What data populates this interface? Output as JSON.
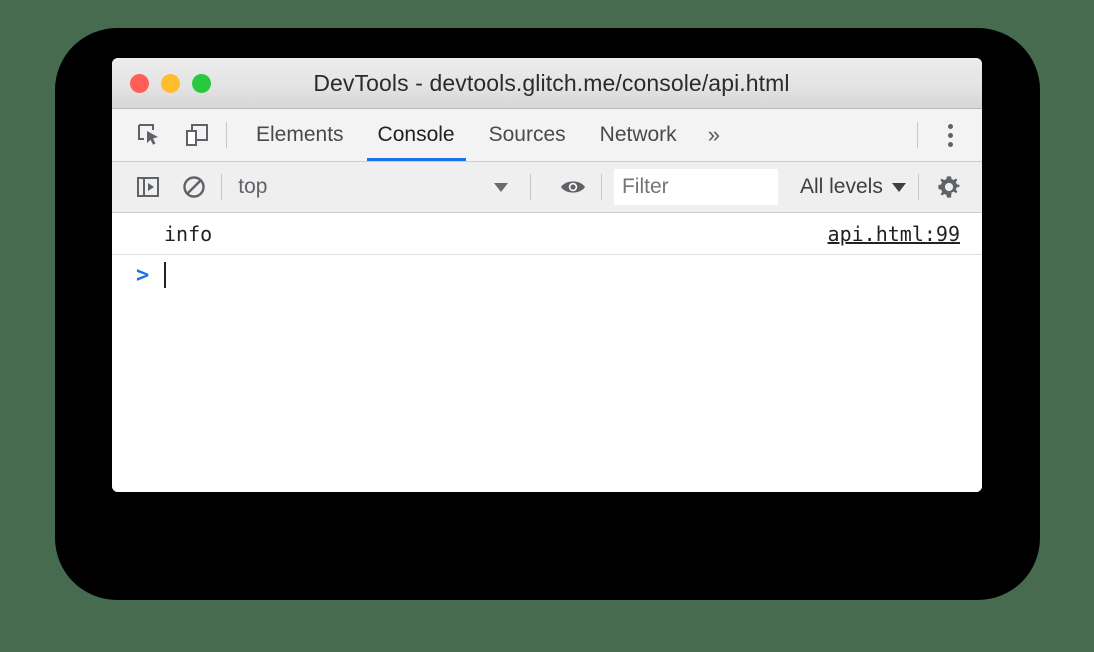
{
  "window": {
    "title": "DevTools - devtools.glitch.me/console/api.html",
    "traffic_lights": [
      {
        "name": "close",
        "color": "#ff5f56"
      },
      {
        "name": "minimize",
        "color": "#ffbd2e"
      },
      {
        "name": "zoom",
        "color": "#27c93f"
      }
    ]
  },
  "tabbar": {
    "icons": [
      {
        "name": "inspect-element-icon"
      },
      {
        "name": "device-toolbar-icon"
      }
    ],
    "tabs": [
      {
        "label": "Elements",
        "active": false
      },
      {
        "label": "Console",
        "active": true
      },
      {
        "label": "Sources",
        "active": false
      },
      {
        "label": "Network",
        "active": false
      }
    ],
    "overflow_label": "»",
    "menu_icon": "kebab-menu-icon",
    "active_underline_color": "#1a73e8"
  },
  "console_toolbar": {
    "sidebar_toggle_icon": "show-console-sidebar-icon",
    "clear_icon": "clear-console-icon",
    "context": {
      "value": "top",
      "options": [
        "top"
      ]
    },
    "eye_icon": "create-live-expression-icon",
    "filter": {
      "value": "",
      "placeholder": "Filter"
    },
    "levels": {
      "label": "All levels"
    },
    "settings_icon": "settings-gear-icon"
  },
  "console": {
    "messages": [
      {
        "text": "info",
        "source": "api.html:99"
      }
    ],
    "prompt": {
      "arrow": ">",
      "value": ""
    }
  },
  "colors": {
    "background": "#476b4e",
    "backdrop": "#000000",
    "accent": "#1a73e8"
  }
}
